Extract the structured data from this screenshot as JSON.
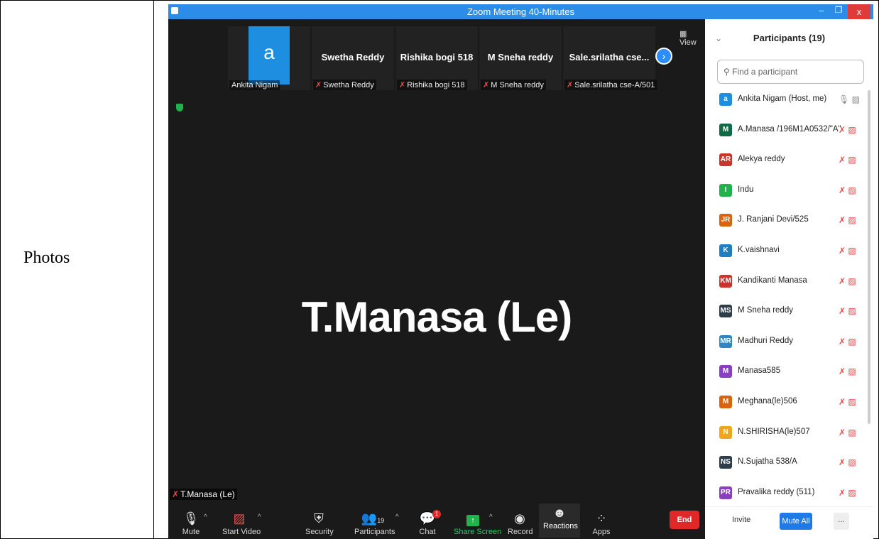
{
  "document": {
    "row_label": "Photos"
  },
  "window": {
    "title": "Zoom Meeting 40-Minutes",
    "min": "–",
    "restore": "❐",
    "close": "x"
  },
  "thumbnails": [
    {
      "name": "",
      "sub": "Ankita Nigam",
      "avatar": "a",
      "muted": false
    },
    {
      "name": "Swetha Reddy",
      "sub": "Swetha Reddy",
      "muted": true
    },
    {
      "name": "Rishika bogi 518",
      "sub": "Rishika bogi 518",
      "muted": true
    },
    {
      "name": "M Sneha reddy",
      "sub": "M Sneha reddy",
      "muted": true
    },
    {
      "name": "Sale.srilatha cse...",
      "sub": "Sale.srilatha cse-A/501",
      "muted": true
    }
  ],
  "video": {
    "view_label": "View",
    "active_speaker": "T.Manasa (Le)",
    "speaker_label": "T.Manasa (Le)"
  },
  "toolbar": {
    "mute": "Mute",
    "start_video": "Start Video",
    "security": "Security",
    "participants": "Participants",
    "participants_count": "19",
    "chat": "Chat",
    "chat_badge": "1",
    "share_screen": "Share Screen",
    "record": "Record",
    "reactions": "Reactions",
    "apps": "Apps",
    "end": "End"
  },
  "panel": {
    "title": "Participants (19)",
    "search_placeholder": "Find a participant",
    "invite": "Invite",
    "mute_all": "Mute All",
    "more": "..."
  },
  "participants": [
    {
      "initials": "a",
      "name": "Ankita Nigam (Host, me)",
      "color": "#1e8ee0",
      "host": true
    },
    {
      "initials": "M",
      "name": "A.Manasa /196M1A0532/\"A\"",
      "color": "#0e6b46"
    },
    {
      "initials": "AR",
      "name": "Alekya reddy",
      "color": "#c9352b"
    },
    {
      "initials": "I",
      "name": "Indu",
      "color": "#22b24c"
    },
    {
      "initials": "JR",
      "name": "J. Ranjani Devi/525",
      "color": "#d9630f"
    },
    {
      "initials": "K",
      "name": "K.vaishnavi",
      "color": "#1f7ec2"
    },
    {
      "initials": "KM",
      "name": "Kandikanti Manasa",
      "color": "#c9352b"
    },
    {
      "initials": "MS",
      "name": "M Sneha reddy",
      "color": "#2e3d4a"
    },
    {
      "initials": "MR",
      "name": "Madhuri Reddy",
      "color": "#2f86c7"
    },
    {
      "initials": "M",
      "name": "Manasa585",
      "color": "#8a3fc2"
    },
    {
      "initials": "M",
      "name": "Meghana(le)506",
      "color": "#d9630f"
    },
    {
      "initials": "N",
      "name": "N.SHIRISHA(le)507",
      "color": "#f0a51b"
    },
    {
      "initials": "NS",
      "name": "N.Sujatha 538/A",
      "color": "#2e3d4a"
    },
    {
      "initials": "PR",
      "name": "Pravalika reddy (511)",
      "color": "#8a3fc2"
    }
  ]
}
